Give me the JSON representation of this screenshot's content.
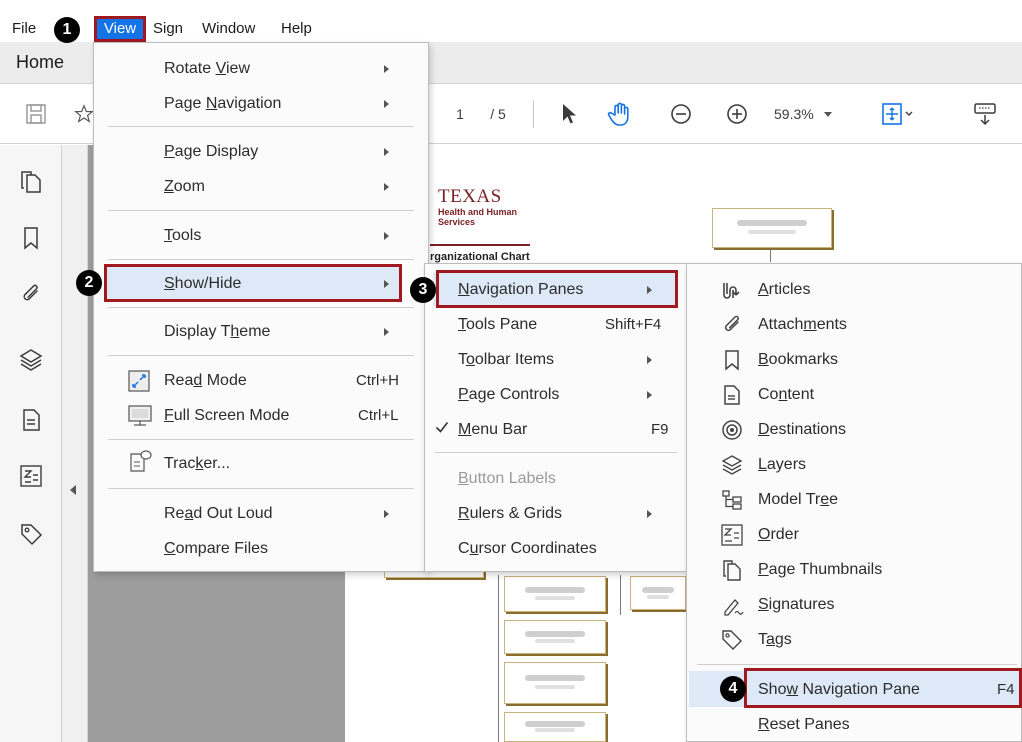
{
  "menubar": {
    "items": [
      "File",
      "View",
      "Sign",
      "Window",
      "Help"
    ]
  },
  "badges": [
    "1",
    "2",
    "3",
    "4"
  ],
  "tabs": {
    "home": "Home"
  },
  "toolbar": {
    "page_current": "1",
    "page_total": "/ 5",
    "zoom": "59.3%"
  },
  "document": {
    "org_title": "TEXAS",
    "org_sub_1": "Health and Human",
    "org_sub_2": "Services",
    "chart_heading": "rganizational Chart"
  },
  "view_menu": {
    "items": [
      {
        "label": "Rotate View",
        "u": "V",
        "pre": "Rotate ",
        "post": "iew"
      },
      {
        "label": "Page Navigation",
        "pre": "Page ",
        "u": "N",
        "post": "avigation"
      },
      {
        "label": "Page Display",
        "pre": "",
        "u": "P",
        "post": "age Display"
      },
      {
        "label": "Zoom",
        "pre": "",
        "u": "Z",
        "post": "oom"
      },
      {
        "label": "Tools",
        "pre": "",
        "u": "T",
        "post": "ools"
      },
      {
        "label": "Show/Hide",
        "pre": "",
        "u": "S",
        "post": "how/Hide"
      },
      {
        "label": "Display Theme",
        "pre": "Display T",
        "u": "h",
        "post": "eme"
      },
      {
        "label": "Read Mode",
        "pre": "Rea",
        "u": "d",
        "post": " Mode",
        "shortcut": "Ctrl+H"
      },
      {
        "label": "Full Screen Mode",
        "pre": "",
        "u": "F",
        "post": "ull Screen Mode",
        "shortcut": "Ctrl+L"
      },
      {
        "label": "Tracker...",
        "pre": "Trac",
        "u": "k",
        "post": "er..."
      },
      {
        "label": "Read Out Loud",
        "pre": "Re",
        "u": "a",
        "post": "d Out Loud"
      },
      {
        "label": "Compare Files",
        "pre": "",
        "u": "C",
        "post": "ompare Files"
      }
    ]
  },
  "showhide_menu": {
    "items": [
      {
        "label": "Navigation Panes",
        "pre": "",
        "u": "N",
        "post": "avigation Panes"
      },
      {
        "label": "Tools Pane",
        "pre": "",
        "u": "T",
        "post": "ools Pane",
        "shortcut": "Shift+F4"
      },
      {
        "label": "Toolbar Items",
        "pre": "T",
        "u": "o",
        "post": "olbar Items"
      },
      {
        "label": "Page Controls",
        "pre": "",
        "u": "P",
        "post": "age Controls"
      },
      {
        "label": "Menu Bar",
        "pre": "",
        "u": "M",
        "post": "enu Bar",
        "shortcut": "F9"
      },
      {
        "label": "Button Labels",
        "pre": "",
        "u": "B",
        "post": "utton Labels"
      },
      {
        "label": "Rulers & Grids",
        "pre": "",
        "u": "R",
        "post": "ulers & Grids"
      },
      {
        "label": "Cursor Coordinates",
        "pre": "C",
        "u": "u",
        "post": "rsor Coordinates"
      }
    ]
  },
  "navpanes_menu": {
    "items": [
      {
        "label": "Articles",
        "pre": "",
        "u": "A",
        "post": "rticles",
        "icon": "articles-icon"
      },
      {
        "label": "Attachments",
        "pre": "Attach",
        "u": "m",
        "post": "ents",
        "icon": "paperclip-icon"
      },
      {
        "label": "Bookmarks",
        "pre": "",
        "u": "B",
        "post": "ookmarks",
        "icon": "bookmark-icon"
      },
      {
        "label": "Content",
        "pre": "Co",
        "u": "n",
        "post": "tent",
        "icon": "content-icon"
      },
      {
        "label": "Destinations",
        "pre": "",
        "u": "D",
        "post": "estinations",
        "icon": "target-icon"
      },
      {
        "label": "Layers",
        "pre": "",
        "u": "L",
        "post": "ayers",
        "icon": "layers-icon"
      },
      {
        "label": "Model Tree",
        "pre": "Model Tr",
        "u": "e",
        "post": "e",
        "icon": "model-tree-icon"
      },
      {
        "label": "Order",
        "pre": "",
        "u": "O",
        "post": "rder",
        "icon": "order-icon"
      },
      {
        "label": "Page Thumbnails",
        "pre": "",
        "u": "P",
        "post": "age Thumbnails",
        "icon": "page-thumbnails-icon"
      },
      {
        "label": "Signatures",
        "pre": "",
        "u": "S",
        "post": "ignatures",
        "icon": "signature-icon"
      },
      {
        "label": "Tags",
        "pre": "T",
        "u": "a",
        "post": "gs",
        "icon": "tag-icon"
      },
      {
        "label": "Show Navigation Pane",
        "pre": "Sho",
        "u": "w",
        "post": " Navigation Pane",
        "shortcut": "F4"
      },
      {
        "label": "Reset Panes",
        "pre": "",
        "u": "R",
        "post": "eset Panes"
      }
    ]
  },
  "colors": {
    "accent_blue": "#1473e6",
    "callout_red": "#a0191e",
    "highlight": "#dde9f6"
  }
}
